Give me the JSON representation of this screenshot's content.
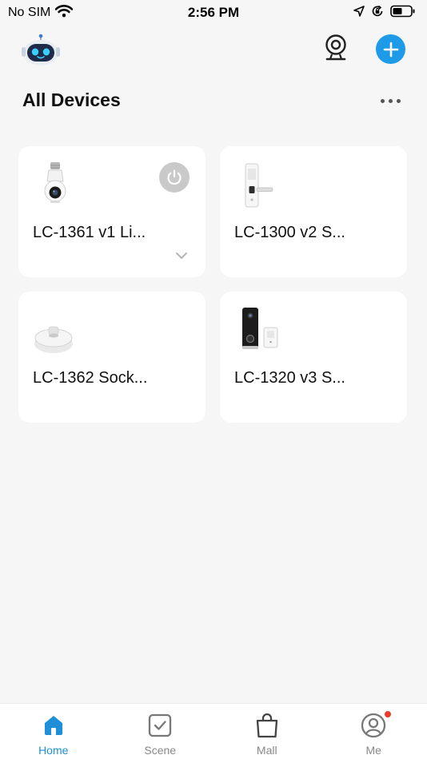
{
  "status_bar": {
    "carrier": "No SIM",
    "time": "2:56 PM",
    "icons": [
      "wifi-icon",
      "location-arrow-icon",
      "orientation-lock-icon",
      "battery-icon"
    ]
  },
  "header": {
    "avatar_icon": "robot-avatar-icon",
    "camera_icon": "webcam-icon",
    "add_icon": "plus-icon",
    "accent_color": "#1e9be8"
  },
  "main": {
    "title": "All Devices",
    "more_icon": "more-dots-icon"
  },
  "devices": [
    {
      "name": "LC-1361 v1 Li...",
      "icon": "bulb-camera-icon",
      "has_power": true,
      "has_expand": true
    },
    {
      "name": "LC-1300 v2 S...",
      "icon": "smart-lock-icon",
      "has_power": false,
      "has_expand": false
    },
    {
      "name": "LC-1362 Sock...",
      "icon": "socket-camera-icon",
      "has_power": false,
      "has_expand": false
    },
    {
      "name": "LC-1320 v3 S...",
      "icon": "doorbell-icon",
      "has_power": false,
      "has_expand": false
    }
  ],
  "tabs": [
    {
      "label": "Home",
      "icon": "home-icon",
      "active": true
    },
    {
      "label": "Scene",
      "icon": "scene-checkbox-icon",
      "active": false
    },
    {
      "label": "Mall",
      "icon": "shopping-bag-icon",
      "active": false
    },
    {
      "label": "Me",
      "icon": "user-icon",
      "active": false,
      "badge": true
    }
  ],
  "colors": {
    "background": "#f6f6f6",
    "card": "#ffffff",
    "active_tab": "#1e8fd8",
    "badge": "#f03a2c"
  }
}
